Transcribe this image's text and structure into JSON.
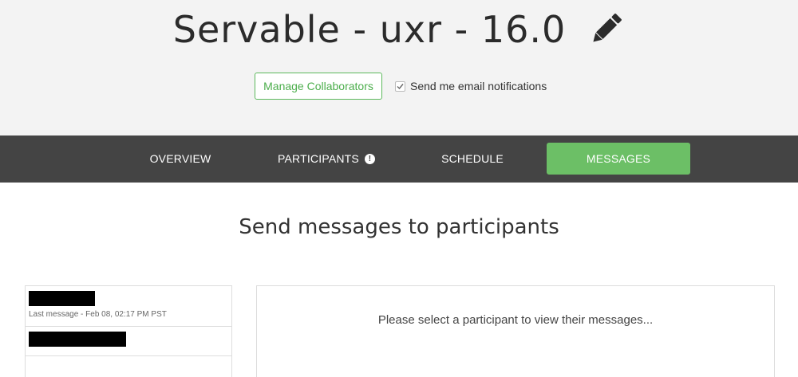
{
  "project": {
    "title": "Servable - uxr - 16.0",
    "edit_icon": "pencil-icon"
  },
  "actions": {
    "manage_collaborators_label": "Manage Collaborators",
    "email_notifications_label": "Send me email notifications",
    "email_notifications_checked": true
  },
  "nav": {
    "tabs": [
      {
        "label": "OVERVIEW",
        "active": false
      },
      {
        "label": "PARTICIPANTS",
        "active": false,
        "icon": "alert-icon"
      },
      {
        "label": "SCHEDULE",
        "active": false
      },
      {
        "label": "MESSAGES",
        "active": true
      }
    ]
  },
  "messages": {
    "heading": "Send messages to participants",
    "participants": [
      {
        "name": "[redacted]",
        "last_message": "Last message - Feb 08, 02:17 PM PST"
      },
      {
        "name": "[redacted]"
      }
    ],
    "empty_state": "Please select a participant to view their messages..."
  },
  "colors": {
    "header_bg": "#f3f3f3",
    "nav_bg": "#444444",
    "accent_green": "#6cbf66",
    "button_border_green": "#5cb85c"
  }
}
